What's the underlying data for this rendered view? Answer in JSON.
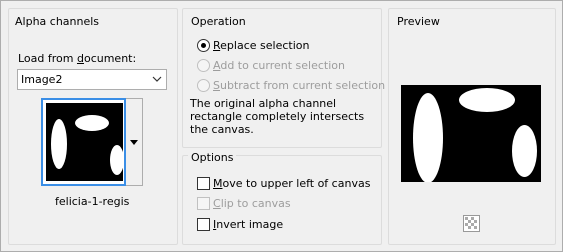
{
  "alpha_group": {
    "title": "Alpha channels",
    "load_label_pre": "Load from ",
    "load_label_ul": "d",
    "load_label_post": "ocument:",
    "document_value": "Image2",
    "channel_name": "felicia-1-regis"
  },
  "operation_group": {
    "title": "Operation",
    "options": [
      {
        "ul": "R",
        "rest": "eplace selection",
        "selected": true,
        "enabled": true
      },
      {
        "ul": "A",
        "rest": "dd to current selection",
        "selected": false,
        "enabled": false
      },
      {
        "ul": "S",
        "rest": "ubtract from current selection",
        "selected": false,
        "enabled": false
      }
    ],
    "description": "The original alpha channel rectangle completely intersects the canvas."
  },
  "options_group": {
    "title": "Options",
    "checks": [
      {
        "ul": "M",
        "rest": "ove to upper left of canvas",
        "checked": false,
        "enabled": true
      },
      {
        "ul": "C",
        "rest": "lip to canvas",
        "checked": false,
        "enabled": false
      },
      {
        "ul": "I",
        "rest": "nvert image",
        "checked": false,
        "enabled": true
      }
    ]
  },
  "preview_group": {
    "title": "Preview"
  },
  "icons": {
    "dropdown": "chevron-down-icon",
    "thumb_dropdown": "caret-down-icon",
    "zoom": "checker-zoom-icon"
  }
}
